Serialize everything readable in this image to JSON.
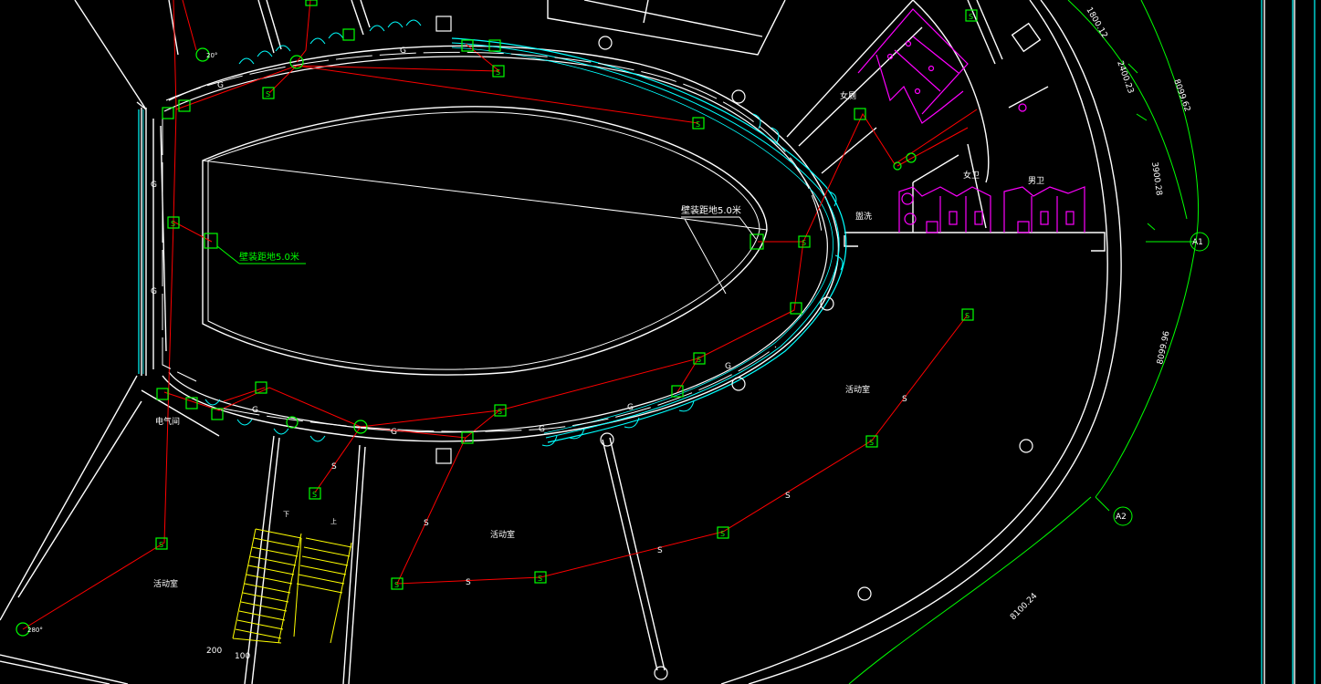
{
  "colors": {
    "background": "#000000",
    "wall": "#ffffff",
    "glass": "#00ffff",
    "pipe": "#ff0000",
    "sprinkler": "#00ff00",
    "dimension": "#00ff00",
    "sanitary": "#ff00ff",
    "stair": "#ffff00"
  },
  "annotations": {
    "install_height_left": "壁装距地5.0米",
    "install_height_right": "壁装距地5.0米",
    "pipe_code_g": "G",
    "pipe_code_s": "S"
  },
  "rooms": {
    "activity_center": "活动室",
    "activity_left": "活动室",
    "activity_bottom_left": "活动室",
    "electrical_room": "电气间",
    "female_restroom": "女卫",
    "male_restroom": "男卫",
    "washroom": "盥洗",
    "women_upper": "女厕"
  },
  "dimensions": {
    "d1": "1800.12",
    "d2": "2400.23",
    "d3": "8099.62",
    "d4": "3900.28",
    "d5": "8099.96",
    "d6": "8100.24",
    "stair_w1": "200",
    "stair_w2": "100"
  },
  "axes": {
    "a1": "A1",
    "a2": "A2"
  },
  "head_angles": {
    "top_left": "20°",
    "bottom_left": "280°"
  },
  "stair_marks": {
    "up": "上",
    "down": "下"
  }
}
